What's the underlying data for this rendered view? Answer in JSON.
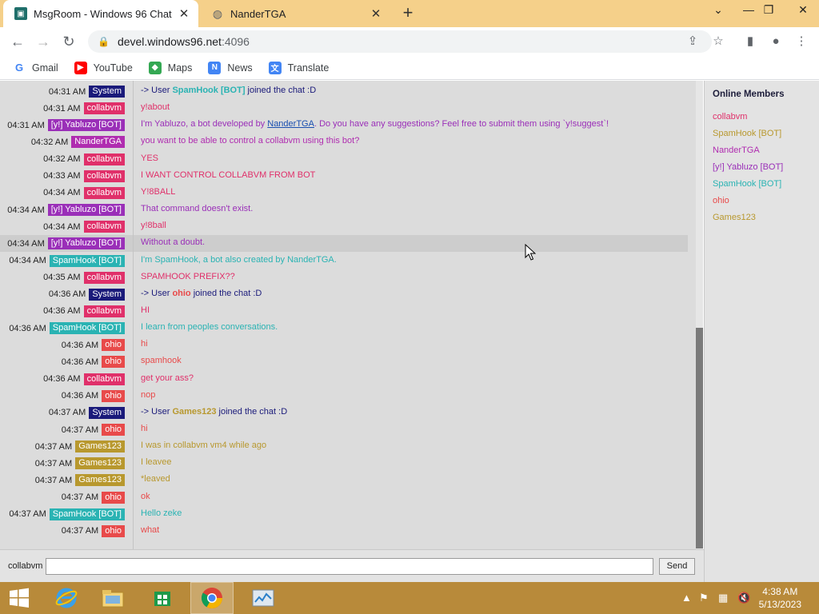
{
  "browser": {
    "tabs": [
      {
        "title": "MsgRoom - Windows 96 Chat",
        "active": true
      },
      {
        "title": "NanderTGA",
        "active": false
      }
    ],
    "url_host": "devel.windows96.net",
    "url_port": ":4096",
    "bookmarks": [
      "Gmail",
      "YouTube",
      "Maps",
      "News",
      "Translate"
    ]
  },
  "colors": {
    "system": "#1a1a7a",
    "collabvm": "#e0306a",
    "yabluzo": "#9a2fb8",
    "nandertga": "#b02db0",
    "spamhook": "#2ab3b3",
    "ohio": "#e84a4a",
    "games123": "#b8982e"
  },
  "messages": [
    {
      "time": "04:31 AM",
      "user": "System",
      "role": "system",
      "text": "-> User ",
      "bold": "SpamHook [BOT]",
      "bold_role": "spamhook",
      "after": " joined the chat :D"
    },
    {
      "time": "04:31 AM",
      "user": "collabvm",
      "role": "collabvm",
      "text": "y!about"
    },
    {
      "time": "04:31 AM",
      "user": "[y!] Yabluzo [BOT]",
      "role": "yabluzo",
      "text": "I'm Yabluzo, a bot developed by ",
      "link": "NanderTGA",
      "after": ". Do you have any suggestions? Feel free to submit them using `y!suggest`!"
    },
    {
      "time": "04:32 AM",
      "user": "NanderTGA",
      "role": "nandertga",
      "text": "you want to be able to control a collabvm using this bot?"
    },
    {
      "time": "04:32 AM",
      "user": "collabvm",
      "role": "collabvm",
      "text": "YES"
    },
    {
      "time": "04:33 AM",
      "user": "collabvm",
      "role": "collabvm",
      "text": "I WANT CONTROL COLLABVM FROM BOT"
    },
    {
      "time": "04:34 AM",
      "user": "collabvm",
      "role": "collabvm",
      "text": "Y!8BALL"
    },
    {
      "time": "04:34 AM",
      "user": "[y!] Yabluzo [BOT]",
      "role": "yabluzo",
      "text": "That command doesn't exist."
    },
    {
      "time": "04:34 AM",
      "user": "collabvm",
      "role": "collabvm",
      "text": "y!8ball"
    },
    {
      "time": "04:34 AM",
      "user": "[y!] Yabluzo [BOT]",
      "role": "yabluzo",
      "text": "Without a doubt.",
      "highlight": true
    },
    {
      "time": "04:34 AM",
      "user": "SpamHook [BOT]",
      "role": "spamhook",
      "text": "I'm SpamHook, a bot also created by NanderTGA."
    },
    {
      "time": "04:35 AM",
      "user": "collabvm",
      "role": "collabvm",
      "text": "SPAMHOOK PREFIX??"
    },
    {
      "time": "04:36 AM",
      "user": "System",
      "role": "system",
      "text": "-> User ",
      "bold": "ohio",
      "bold_role": "ohio",
      "after": " joined the chat :D"
    },
    {
      "time": "04:36 AM",
      "user": "collabvm",
      "role": "collabvm",
      "text": "HI"
    },
    {
      "time": "04:36 AM",
      "user": "SpamHook [BOT]",
      "role": "spamhook",
      "text": "I learn from peoples conversations."
    },
    {
      "time": "04:36 AM",
      "user": "ohio",
      "role": "ohio",
      "text": "hi"
    },
    {
      "time": "04:36 AM",
      "user": "ohio",
      "role": "ohio",
      "text": "spamhook"
    },
    {
      "time": "04:36 AM",
      "user": "collabvm",
      "role": "collabvm",
      "text": "get your ass?"
    },
    {
      "time": "04:36 AM",
      "user": "ohio",
      "role": "ohio",
      "text": "nop"
    },
    {
      "time": "04:37 AM",
      "user": "System",
      "role": "system",
      "text": "-> User ",
      "bold": "Games123",
      "bold_role": "games123",
      "after": " joined the chat :D"
    },
    {
      "time": "04:37 AM",
      "user": "ohio",
      "role": "ohio",
      "text": "hi"
    },
    {
      "time": "04:37 AM",
      "user": "Games123",
      "role": "games123",
      "text": "I was in collabvm vm4 while ago"
    },
    {
      "time": "04:37 AM",
      "user": "Games123",
      "role": "games123",
      "text": "I leavee"
    },
    {
      "time": "04:37 AM",
      "user": "Games123",
      "role": "games123",
      "text": "*leaved"
    },
    {
      "time": "04:37 AM",
      "user": "ohio",
      "role": "ohio",
      "text": "ok"
    },
    {
      "time": "04:37 AM",
      "user": "SpamHook [BOT]",
      "role": "spamhook",
      "text": "Hello zeke"
    },
    {
      "time": "04:37 AM",
      "user": "ohio",
      "role": "ohio",
      "text": "what"
    }
  ],
  "members": {
    "title": "Online Members",
    "list": [
      {
        "name": "collabvm",
        "role": "collabvm"
      },
      {
        "name": "SpamHook [BOT]",
        "role": "games123"
      },
      {
        "name": "NanderTGA",
        "role": "nandertga"
      },
      {
        "name": "[y!] Yabluzo [BOT]",
        "role": "yabluzo"
      },
      {
        "name": "SpamHook [BOT]",
        "role": "spamhook"
      },
      {
        "name": "ohio",
        "role": "ohio"
      },
      {
        "name": "Games123",
        "role": "games123"
      }
    ]
  },
  "input": {
    "username": "collabvm",
    "value": "",
    "send_label": "Send"
  },
  "taskbar": {
    "time": "4:38 AM",
    "date": "5/13/2023"
  }
}
